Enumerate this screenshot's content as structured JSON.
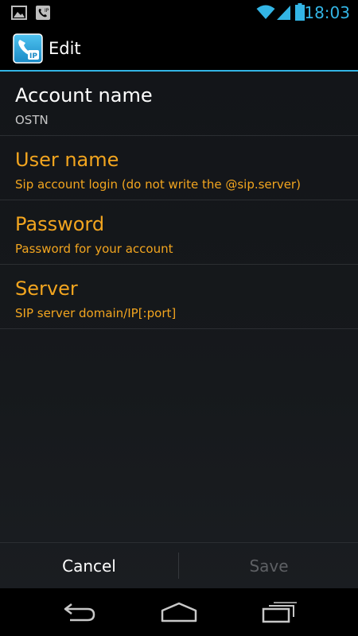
{
  "status_bar": {
    "time": "18:03",
    "icons": [
      "image-notification-icon",
      "phone-notification-icon",
      "wifi-icon",
      "signal-icon",
      "battery-icon"
    ],
    "accent": "#33b5e5"
  },
  "action_bar": {
    "title": "Edit",
    "app_icon": "ip-phone-app-icon"
  },
  "preferences": [
    {
      "title": "Account name",
      "summary": "OSTN",
      "state": "normal"
    },
    {
      "title": "User name",
      "summary": "Sip account login (do not write the @sip.server)",
      "state": "required"
    },
    {
      "title": "Password",
      "summary": "Password for your account",
      "state": "required"
    },
    {
      "title": "Server",
      "summary": "SIP server domain/IP[:port]",
      "state": "required"
    }
  ],
  "buttons": {
    "cancel_label": "Cancel",
    "save_label": "Save",
    "save_enabled": false
  },
  "nav_bar": {
    "icons": [
      "back-icon",
      "home-icon",
      "recent-apps-icon"
    ]
  },
  "colors": {
    "required": "#f2a51f",
    "accent": "#33b5e5"
  }
}
